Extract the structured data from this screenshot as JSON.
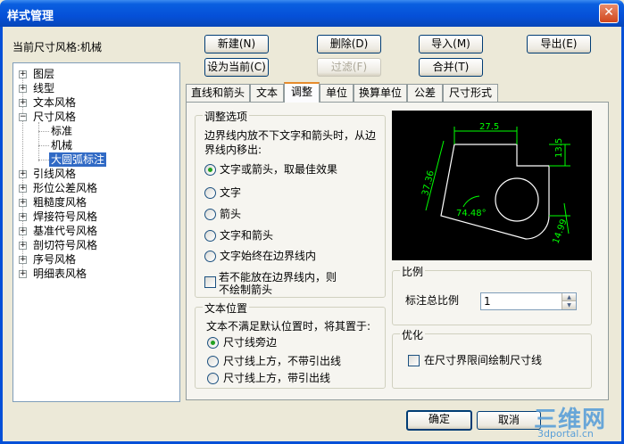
{
  "window": {
    "title": "样式管理",
    "close_label": "✕"
  },
  "current_style_label": "当前尺寸风格:机械",
  "buttons": {
    "new": "新建(N)",
    "delete": "删除(D)",
    "import": "导入(M)",
    "export": "导出(E)",
    "set_current": "设为当前(C)",
    "filter": "过滤(F)",
    "merge": "合并(T)",
    "ok": "确定",
    "cancel": "取消"
  },
  "tree": {
    "items": [
      {
        "label": "图层",
        "expander": "+"
      },
      {
        "label": "线型",
        "expander": "+"
      },
      {
        "label": "文本风格",
        "expander": "+"
      },
      {
        "label": "尺寸风格",
        "expander": "−"
      },
      {
        "label": "标准"
      },
      {
        "label": "机械"
      },
      {
        "label": "大圆弧标注",
        "selected": true
      },
      {
        "label": "引线风格",
        "expander": "+"
      },
      {
        "label": "形位公差风格",
        "expander": "+"
      },
      {
        "label": "粗糙度风格",
        "expander": "+"
      },
      {
        "label": "焊接符号风格",
        "expander": "+"
      },
      {
        "label": "基准代号风格",
        "expander": "+"
      },
      {
        "label": "剖切符号风格",
        "expander": "+"
      },
      {
        "label": "序号风格",
        "expander": "+"
      },
      {
        "label": "明细表风格",
        "expander": "+"
      }
    ]
  },
  "tabs": [
    "直线和箭头",
    "文本",
    "调整",
    "单位",
    "换算单位",
    "公差",
    "尺寸形式"
  ],
  "active_tab": "调整",
  "adjust_options": {
    "legend": "调整选项",
    "description": [
      "边界线内放不下文字和箭头时，从边",
      "界线内移出:"
    ],
    "radios": [
      "文字或箭头，取最佳效果",
      "文字",
      "箭头",
      "文字和箭头",
      "文字始终在边界线内"
    ],
    "selected_index": 0,
    "checkbox_lines": [
      "若不能放在边界线内，则",
      "不绘制箭头"
    ]
  },
  "text_position": {
    "legend": "文本位置",
    "description": "文本不满足默认位置时，将其置于:",
    "radios": [
      "尺寸线旁边",
      "尺寸线上方，不带引出线",
      "尺寸线上方，带引出线"
    ],
    "selected_index": 0
  },
  "scale": {
    "legend": "比例",
    "label": "标注总比例",
    "value": "1"
  },
  "optimize": {
    "legend": "优化",
    "checkbox": "在尺寸界限间绘制尺寸线"
  },
  "preview": {
    "dims": {
      "top": "27.5",
      "right_vertical": "13.5",
      "left_slanted": "37.36",
      "angle": "74.48°",
      "bottom_right": "14.99"
    },
    "colors": {
      "part": "#ffffff",
      "dimension": "#00ff00",
      "background": "#000000"
    }
  },
  "watermark": {
    "big": "三维网",
    "small": "3dportal.cn"
  }
}
